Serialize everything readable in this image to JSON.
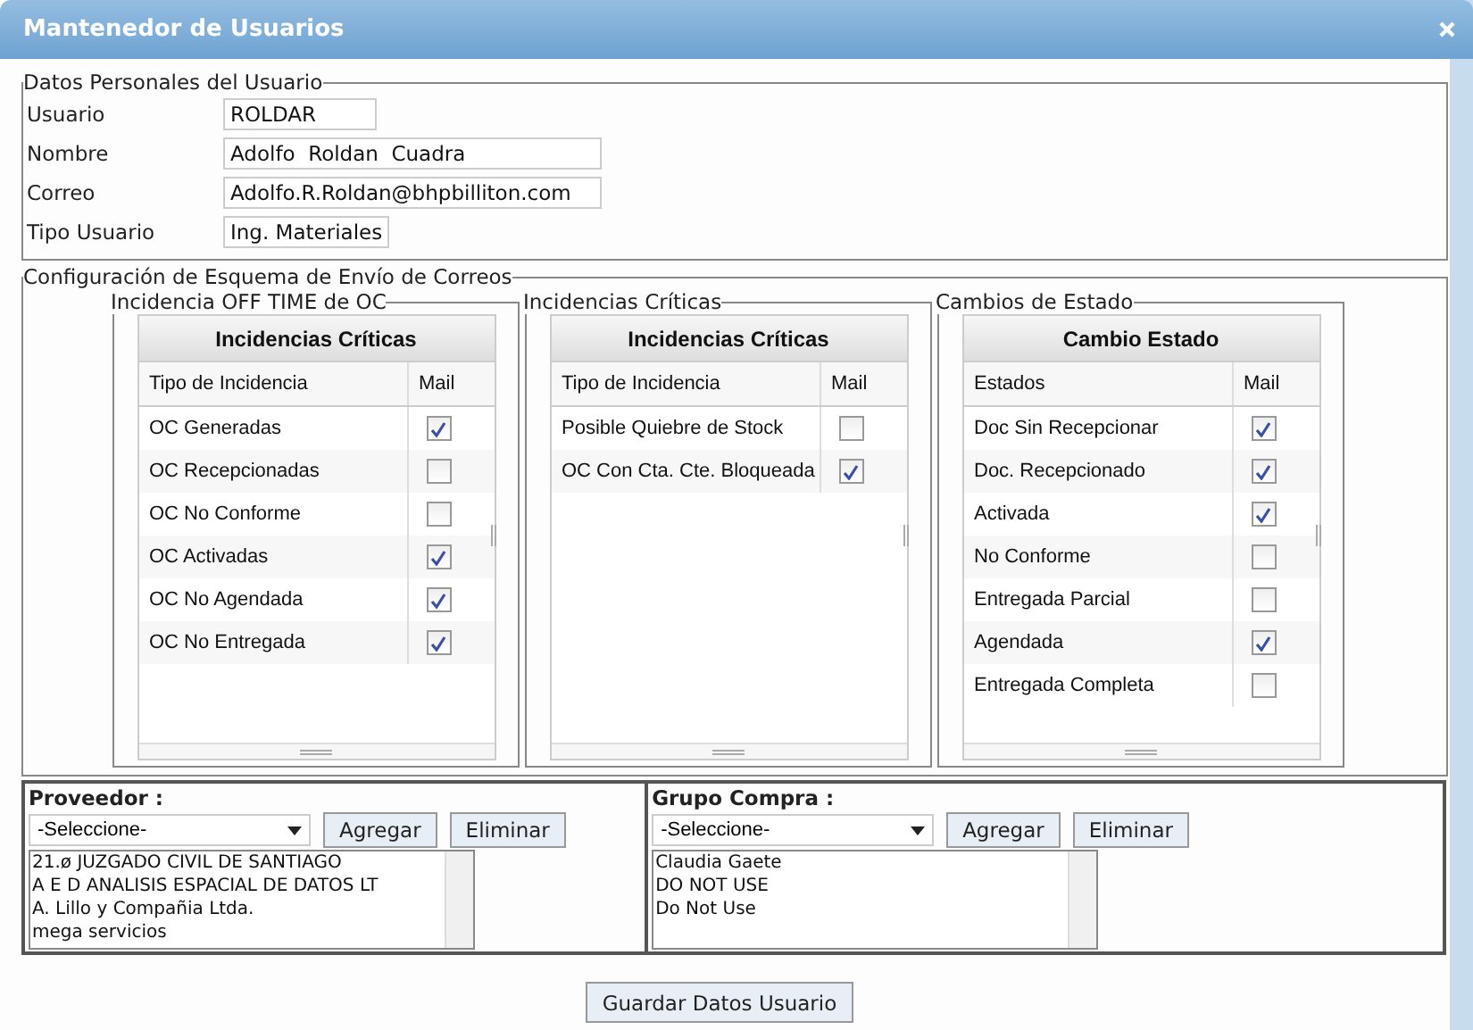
{
  "window": {
    "title": "Mantenedor de Usuarios"
  },
  "personal": {
    "legend": "Datos Personales del Usuario",
    "fields": [
      {
        "label": "Usuario",
        "value": "ROLDAR"
      },
      {
        "label": "Nombre",
        "value": "Adolfo  Roldan  Cuadra"
      },
      {
        "label": "Correo",
        "value": "Adolfo.R.Roldan@bhpbilliton.com"
      },
      {
        "label": "Tipo Usuario",
        "value": "Ing. Materiales"
      }
    ]
  },
  "mail_config": {
    "legend": "Configuración de Esquema de Envío de Correos",
    "groups": [
      {
        "legend": "Incidencia OFF TIME de OC",
        "grid_title": "Incidencias Críticas",
        "columns": [
          "Tipo de Incidencia",
          "Mail"
        ],
        "rows": [
          {
            "name": "OC Generadas",
            "checked": true
          },
          {
            "name": "OC Recepcionadas",
            "checked": false
          },
          {
            "name": "OC No Conforme",
            "checked": false
          },
          {
            "name": "OC Activadas",
            "checked": true
          },
          {
            "name": "OC No Agendada",
            "checked": true
          },
          {
            "name": "OC No Entregada",
            "checked": true
          }
        ]
      },
      {
        "legend": "Incidencias Críticas",
        "grid_title": "Incidencias Críticas",
        "columns": [
          "Tipo de Incidencia",
          "Mail"
        ],
        "rows": [
          {
            "name": "Posible Quiebre de Stock",
            "checked": false
          },
          {
            "name": "OC Con Cta. Cte. Bloqueada",
            "checked": true
          }
        ]
      },
      {
        "legend": "Cambios de Estado",
        "grid_title": "Cambio Estado",
        "columns": [
          "Estados",
          "Mail"
        ],
        "rows": [
          {
            "name": "Doc Sin Recepcionar",
            "checked": true
          },
          {
            "name": "Doc. Recepcionado",
            "checked": true
          },
          {
            "name": "Activada",
            "checked": true
          },
          {
            "name": "No Conforme",
            "checked": false
          },
          {
            "name": "Entregada Parcial",
            "checked": false
          },
          {
            "name": "Agendada",
            "checked": true
          },
          {
            "name": "Entregada Completa",
            "checked": false
          }
        ]
      }
    ]
  },
  "pickers": [
    {
      "label": "Proveedor :",
      "select": "-Seleccione-",
      "buttons": [
        "Agregar",
        "Eliminar"
      ],
      "items": [
        "21.ø JUZGADO CIVIL DE SANTIAGO",
        "A E D ANALISIS ESPACIAL DE DATOS LT",
        "A. Lillo y Compañia Ltda.",
        "mega servicios"
      ]
    },
    {
      "label": "Grupo Compra :",
      "select": "-Seleccione-",
      "buttons": [
        "Agregar",
        "Eliminar"
      ],
      "items": [
        "Claudia Gaete",
        "DO NOT USE",
        "Do Not Use"
      ]
    }
  ],
  "save_button": "Guardar Datos Usuario"
}
